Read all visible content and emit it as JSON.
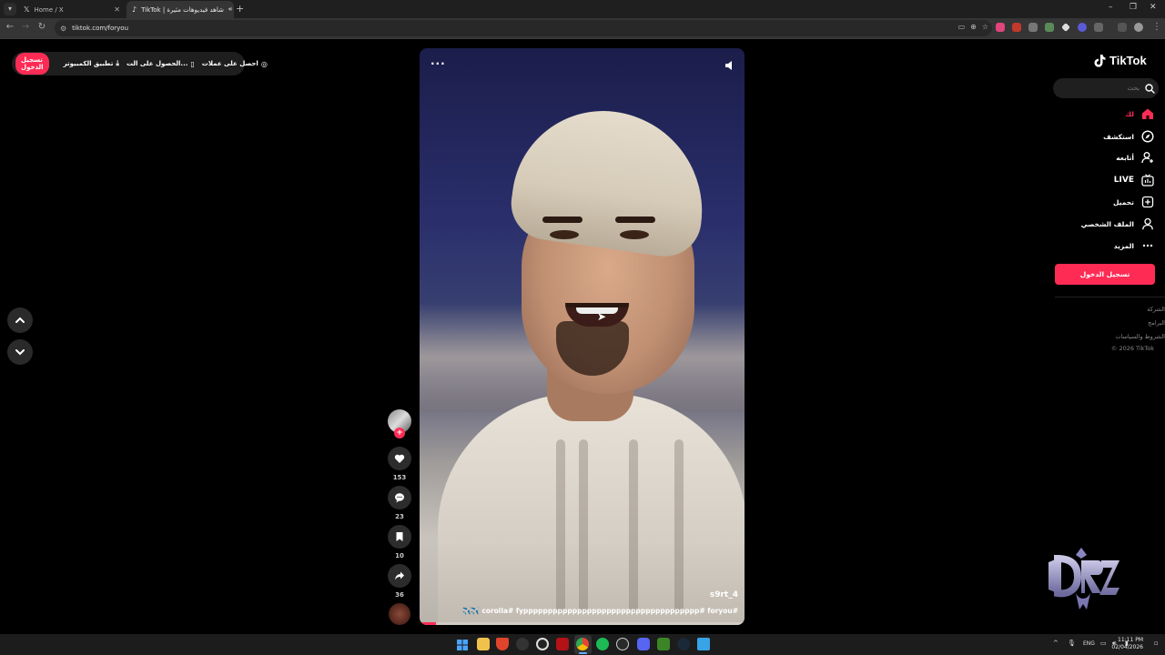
{
  "browser": {
    "tabs": [
      {
        "label": "Home / X",
        "favicon": "x-logo-icon"
      },
      {
        "label": "شاهد فيديوهات مثيرة | TikTok",
        "favicon": "tiktok-logo-icon"
      }
    ],
    "url": "tiktok.com/foryou"
  },
  "top_pill": {
    "login_label": "تسجيل الدخول",
    "desktop_app_label": "تطبيق الكمبيوتر",
    "get_on_label": "الحصول على الت...",
    "coins_label": "احصل على عملات"
  },
  "video": {
    "username": "s9rt_4",
    "caption": "✈️✈️ corolla# fypppppppppppppppppppppppppppppppppppp# foryou#",
    "progress": 0.05
  },
  "actions": {
    "likes": "153",
    "comments": "23",
    "saves": "10",
    "shares": "36"
  },
  "sidebar": {
    "brand": "TikTok",
    "search_placeholder": "بحث",
    "items": [
      {
        "label": "لك",
        "icon": "home-icon",
        "active": true
      },
      {
        "label": "استكشف",
        "icon": "compass-icon",
        "active": false
      },
      {
        "label": "أتابعه",
        "icon": "user-plus-icon",
        "active": false
      },
      {
        "label": "LIVE",
        "icon": "live-tv-icon",
        "active": false
      },
      {
        "label": "تحميل",
        "icon": "upload-icon",
        "active": false
      },
      {
        "label": "الملف الشخصي",
        "icon": "profile-icon",
        "active": false
      },
      {
        "label": "المزيد",
        "icon": "more-icon",
        "active": false
      }
    ],
    "login_button": "تسجيل الدخول",
    "footer": [
      "الشركة",
      "البرامج",
      "الشروط والسياسات",
      "© 2026 TikTok"
    ]
  },
  "taskbar": {
    "language": "ENG",
    "time": "11:11 PM",
    "date": "02/04/2026"
  },
  "colors": {
    "accent": "#fe2c55",
    "background": "#000000",
    "panel": "#1f1f1f"
  }
}
